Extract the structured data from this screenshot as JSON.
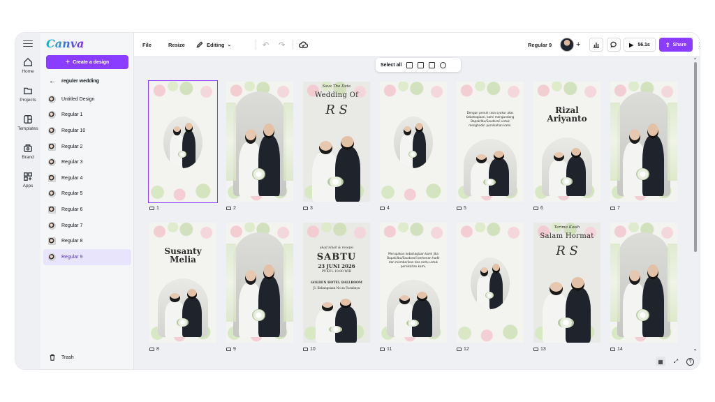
{
  "app": {
    "logo": "Canva"
  },
  "rail": [
    {
      "label": "Home",
      "icon": "home-icon"
    },
    {
      "label": "Projects",
      "icon": "folder-icon"
    },
    {
      "label": "Templates",
      "icon": "templates-icon"
    },
    {
      "label": "Brand",
      "icon": "brand-icon"
    },
    {
      "label": "Apps",
      "icon": "apps-icon"
    }
  ],
  "panel": {
    "create_label": "Create a design",
    "folder_title": "reguler wedding",
    "items": [
      "Untitled Design",
      "Regular 1",
      "Regular 10",
      "Regular 2",
      "Regular 3",
      "Regular 4",
      "Regular 5",
      "Regular 6",
      "Regular 7",
      "Regular 8",
      "Regular 9"
    ],
    "active_index": 10,
    "trash_label": "Trash"
  },
  "topbar": {
    "file": "File",
    "resize": "Resize",
    "editing": "Editing",
    "doc_title": "Regular 9",
    "play_time": "56.1s",
    "share": "Share"
  },
  "selection_bar": {
    "select_all": "Select all"
  },
  "pages": [
    {
      "n": "1",
      "layout": "oval-small",
      "selected": true
    },
    {
      "n": "2",
      "layout": "arch-full"
    },
    {
      "n": "3",
      "layout": "title",
      "small": "Save The Date",
      "title": "Wedding Of",
      "mono": "R S"
    },
    {
      "n": "4",
      "layout": "oval-small"
    },
    {
      "n": "5",
      "layout": "verse",
      "verse": "Dengan penuh rasa syukur atas kebahagiaan, kami mengundang Bapak/Ibu/Saudara/i untuk menghadiri pernikahan kami."
    },
    {
      "n": "6",
      "layout": "name",
      "name1": "Rizal",
      "name2": "Ariyanto"
    },
    {
      "n": "7",
      "layout": "arch-full"
    },
    {
      "n": "8",
      "layout": "name",
      "name1": "Susanty",
      "name2": "Melia"
    },
    {
      "n": "9",
      "layout": "arch-full"
    },
    {
      "n": "10",
      "layout": "date",
      "small": "akad nikah & resepsi",
      "day": "SABTU",
      "date": "23 JUNI 2026",
      "time": "PUKUL 10:00 WIB",
      "venue": "GOLDEN HOTEL BALLROOM",
      "addr": "Jl. Kebangsaan No xx Surabaya"
    },
    {
      "n": "11",
      "layout": "verse",
      "verse": "Merupakan kebahagiaan kami jika Bapak/Ibu/Saudara/i berkenan hadir dan memberikan doa restu untuk pernikahan kami."
    },
    {
      "n": "12",
      "layout": "oval-small"
    },
    {
      "n": "13",
      "layout": "title",
      "small": "Terima Kasih",
      "title": "Salam Hormat",
      "mono": "R S"
    },
    {
      "n": "14",
      "layout": "arch-full"
    }
  ],
  "colors": {
    "accent": "#8b3dff",
    "canvas_bg": "#eef0f3"
  }
}
